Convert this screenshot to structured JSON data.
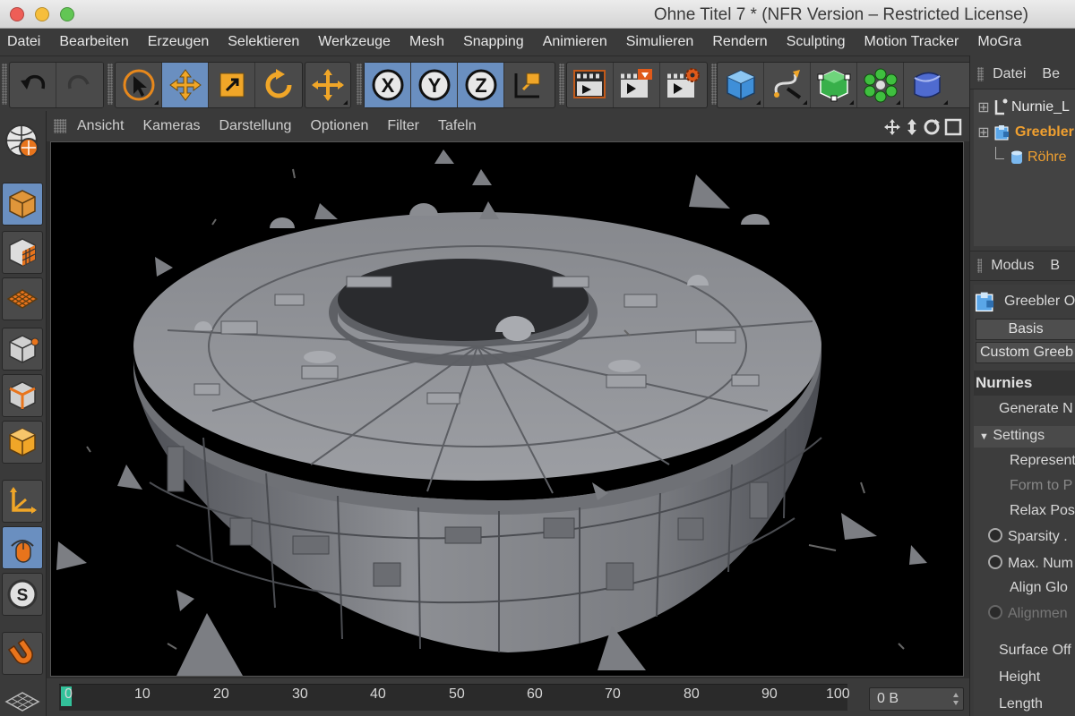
{
  "window": {
    "title": "Ohne Titel 7 * (NFR Version – Restricted License)"
  },
  "menubar": {
    "items": [
      "Datei",
      "Bearbeiten",
      "Erzeugen",
      "Selektieren",
      "Werkzeuge",
      "Mesh",
      "Snapping",
      "Animieren",
      "Simulieren",
      "Rendern",
      "Sculpting",
      "Motion Tracker",
      "MoGra"
    ]
  },
  "toolbar": {
    "icons": [
      "undo-icon",
      "redo-icon",
      "select-arrow-icon",
      "move-icon",
      "scale-icon",
      "rotate-icon",
      "live-select-icon",
      "x-axis-icon",
      "y-axis-icon",
      "z-axis-icon",
      "coordinate-system-icon",
      "render-view-icon",
      "render-picture-viewer-icon",
      "render-settings-icon",
      "cube-object-icon",
      "spline-pen-icon",
      "subdivision-icon",
      "cloner-icon",
      "deformer-icon"
    ],
    "axis_labels": [
      "X",
      "Y",
      "Z"
    ],
    "active_color": "#6a8fc0"
  },
  "viewport": {
    "menu": [
      "Ansicht",
      "Kameras",
      "Darstellung",
      "Optionen",
      "Filter",
      "Tafeln"
    ]
  },
  "left_tools": {
    "icons": [
      "view-icon",
      "model-mode-icon",
      "texture-mode-icon",
      "workplane-icon",
      "points-mode-icon",
      "edges-mode-icon",
      "polygons-mode-icon",
      "axis-mode-icon",
      "tweak-mode-icon",
      "solo-icon",
      "snap-magnet-icon"
    ],
    "solo_label": "S"
  },
  "timeline": {
    "ticks": [
      "0",
      "10",
      "20",
      "30",
      "40",
      "50",
      "60",
      "70",
      "80",
      "90",
      "100"
    ],
    "frame_value": "0 B",
    "marker_color": "#33c19a"
  },
  "objects_panel": {
    "tabs": [
      "Datei",
      "Be"
    ],
    "items": [
      {
        "name": "Nurnie_L",
        "color": "#e8e8e8"
      },
      {
        "name": "Greebler",
        "color": "#f0a030"
      },
      {
        "name": "Röhre",
        "color": "#f0a030"
      }
    ]
  },
  "attributes_panel": {
    "tabs": [
      "Modus",
      "B"
    ],
    "object_name": "Greebler O",
    "basis_tab": "Basis",
    "custom_tab": "Custom Greeb",
    "section": "Nurnies",
    "rows": [
      {
        "label": "Generate N",
        "state": "normal"
      },
      {
        "label": "Settings",
        "state": "group"
      },
      {
        "label": "Represent",
        "state": "normal"
      },
      {
        "label": "Form to P",
        "state": "disabled"
      },
      {
        "label": "Relax Pos",
        "state": "normal"
      },
      {
        "label": "Sparsity .",
        "state": "radio"
      },
      {
        "label": "Max. Num",
        "state": "radio"
      },
      {
        "label": "Align Glo",
        "state": "normal"
      },
      {
        "label": "Alignmen",
        "state": "radio-disabled"
      },
      {
        "label": "Surface Off",
        "state": "normal"
      },
      {
        "label": "Height",
        "state": "normal"
      },
      {
        "label": "Length",
        "state": "normal"
      }
    ]
  }
}
